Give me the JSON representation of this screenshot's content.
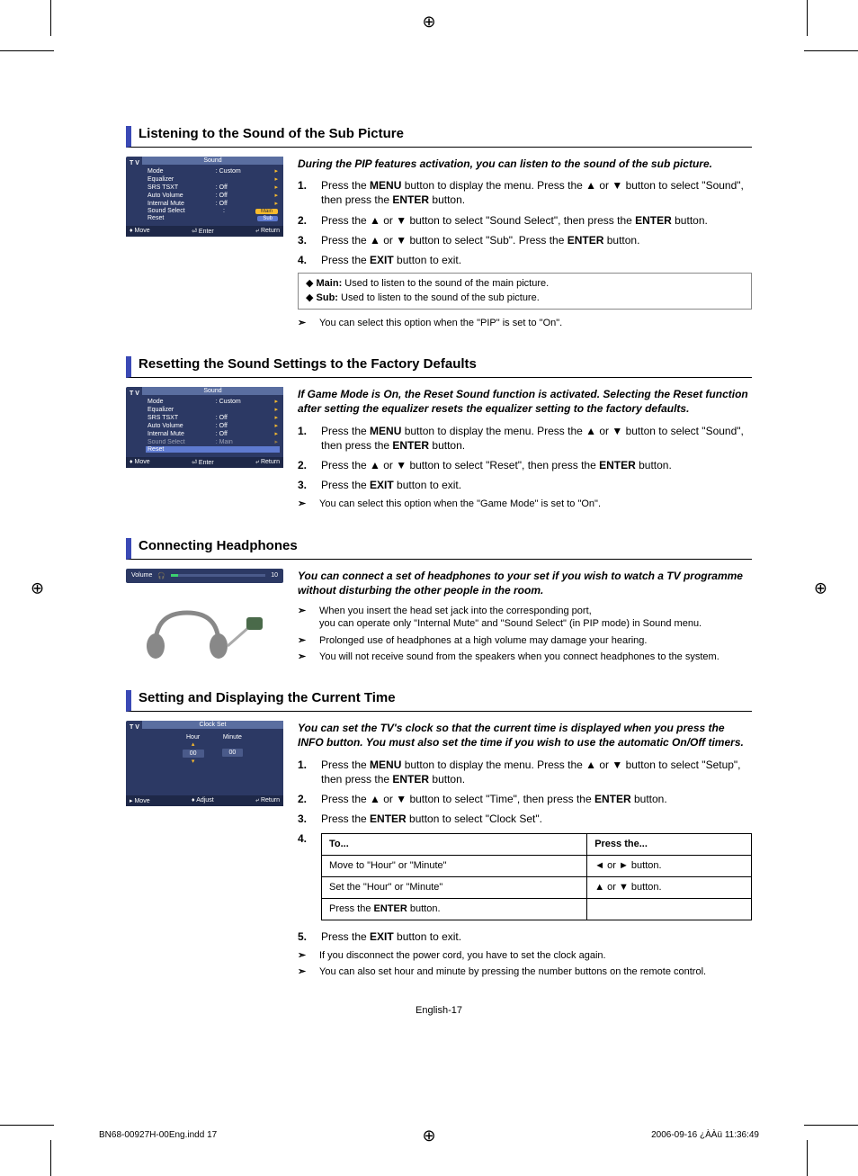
{
  "s1": {
    "heading": "Listening to the Sound of the Sub Picture",
    "thumb": {
      "tv": "T V",
      "title": "Sound",
      "rows": [
        {
          "label": "Mode",
          "val": ": Custom"
        },
        {
          "label": "Equalizer",
          "val": ""
        },
        {
          "label": "SRS TSXT",
          "val": ": Off"
        },
        {
          "label": "Auto Volume",
          "val": ": Off"
        },
        {
          "label": "Internal Mute",
          "val": ": Off"
        },
        {
          "label": "Sound Select",
          "val": ":",
          "main": "Main"
        },
        {
          "label": "Reset",
          "val": "",
          "sub": "Sub"
        }
      ],
      "bar": {
        "move": "Move",
        "enter": "Enter",
        "ret": "Return"
      }
    },
    "intro": "During the PIP features activation, you can listen to the sound of the sub picture.",
    "steps": [
      {
        "n": "1.",
        "pre": "Press the ",
        "b1": "MENU",
        "mid": " button to display the menu. Press the ▲ or ▼ button to select \"Sound\", then press the ",
        "b2": "ENTER",
        "post": " button."
      },
      {
        "n": "2.",
        "pre": "Press the ▲ or ▼ button to select \"Sound Select\", then press the ",
        "b1": "ENTER",
        "post": " button."
      },
      {
        "n": "3.",
        "pre": "Press the ▲ or ▼ button to select \"Sub\". Press the ",
        "b1": "ENTER",
        "post": " button."
      },
      {
        "n": "4.",
        "pre": "Press the ",
        "b1": "EXIT",
        "post": " button to exit."
      }
    ],
    "box": [
      {
        "b": "Main:",
        "t": " Used to listen to the sound of the main picture."
      },
      {
        "b": "Sub:",
        "t": " Used to listen to the sound of the sub picture."
      }
    ],
    "note": "You can select this option when the \"PIP\" is set to \"On\"."
  },
  "s2": {
    "heading": "Resetting the Sound Settings to the Factory Defaults",
    "thumb": {
      "tv": "T V",
      "title": "Sound",
      "rows": [
        {
          "label": "Mode",
          "val": ": Custom"
        },
        {
          "label": "Equalizer",
          "val": ""
        },
        {
          "label": "SRS TSXT",
          "val": ": Off"
        },
        {
          "label": "Auto Volume",
          "val": ": Off"
        },
        {
          "label": "Internal Mute",
          "val": ": Off"
        },
        {
          "label": "Sound Select",
          "val": ": Main",
          "dim": true
        },
        {
          "label": "Reset",
          "val": "",
          "sel": true
        }
      ],
      "bar": {
        "move": "Move",
        "enter": "Enter",
        "ret": "Return"
      }
    },
    "intro": "If Game Mode is On, the Reset Sound function is activated. Selecting the Reset function after setting the equalizer resets the equalizer setting to the factory defaults.",
    "steps": [
      {
        "n": "1.",
        "pre": "Press the ",
        "b1": "MENU",
        "mid": " button to display the menu. Press the ▲ or ▼ button to select \"Sound\", then press the ",
        "b2": "ENTER",
        "post": " button."
      },
      {
        "n": "2.",
        "pre": "Press the ▲ or ▼ button to select \"Reset\", then press the ",
        "b1": "ENTER",
        "post": " button."
      },
      {
        "n": "3.",
        "pre": "Press the ",
        "b1": "EXIT",
        "post": " button to exit."
      }
    ],
    "note": "You can select this option when the \"Game Mode\" is set to \"On\"."
  },
  "s3": {
    "heading": "Connecting Headphones",
    "vol_label": "Volume",
    "vol_val": "10",
    "intro": "You can connect a set of headphones to your set if you wish to watch a TV programme without disturbing the other people in the room.",
    "notes": [
      "When you insert the head set jack into the corresponding port,\nyou can operate only \"Internal Mute\" and \"Sound Select\" (in PIP mode) in Sound menu.",
      "Prolonged use of headphones at a high volume may damage your hearing.",
      "You will not receive sound from the speakers when you connect headphones to the system."
    ]
  },
  "s4": {
    "heading": "Setting and Displaying the Current Time",
    "thumb": {
      "tv": "T V",
      "title": "Clock Set",
      "hour": "Hour",
      "minute": "Minute",
      "hv": "00",
      "mv": "00",
      "bar": {
        "move": "Move",
        "adjust": "Adjust",
        "ret": "Return"
      }
    },
    "intro": "You can set the TV's clock so that the current time is displayed when you press the INFO button. You must also set the time if you wish to use the automatic On/Off timers.",
    "steps": [
      {
        "n": "1.",
        "pre": "Press the ",
        "b1": "MENU",
        "mid": " button to display the menu. Press the ▲ or ▼ button to select \"Setup\", then press the ",
        "b2": "ENTER",
        "post": " button."
      },
      {
        "n": "2.",
        "pre": "Press the ▲ or ▼ button to select \"Time\", then press the ",
        "b1": "ENTER",
        "post": " button."
      },
      {
        "n": "3.",
        "pre": "Press the ",
        "b1": "ENTER",
        "post": " button to select \"Clock Set\"."
      },
      {
        "n": "4."
      },
      {
        "n": "5.",
        "pre": "Press the ",
        "b1": "EXIT",
        "post": " button to exit."
      }
    ],
    "table": {
      "h1": "To...",
      "h2": "Press the...",
      "r1a": "Move to \"Hour\" or \"Minute\"",
      "r1b": "◄ or ► button.",
      "r2a": "Set the \"Hour\" or \"Minute\"",
      "r2b": "▲ or ▼ button.",
      "r3a_pre": "Press the ",
      "r3a_b": "ENTER",
      "r3a_post": " button.",
      "r3b": ""
    },
    "notes": [
      "If you disconnect the power cord, you have to set the clock again.",
      "You can also set hour and minute by pressing the number buttons on the remote control."
    ]
  },
  "page_num": "English-17",
  "footer_left": "BN68-00927H-00Eng.indd   17",
  "footer_right": "2006-09-16   ¿ÀÀü 11:36:49"
}
